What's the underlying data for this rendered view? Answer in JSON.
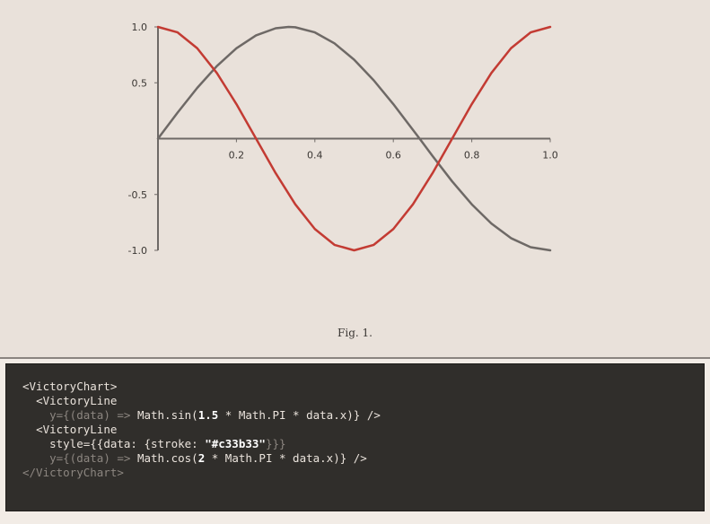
{
  "chart_data": {
    "type": "line",
    "xlim": [
      0,
      1
    ],
    "ylim": [
      -1,
      1
    ],
    "x_ticks": [
      "0.2",
      "0.4",
      "0.6",
      "0.8",
      "1.0"
    ],
    "x_tick_values": [
      0.2,
      0.4,
      0.6,
      0.8,
      1.0
    ],
    "y_ticks": [
      "1.0",
      "0.5",
      "-0.5",
      "-1.0"
    ],
    "y_tick_values": [
      1.0,
      0.5,
      -0.5,
      -1.0
    ],
    "grid": false,
    "legend": "none",
    "series": [
      {
        "color": "#6e6966",
        "x": [
          0,
          0.05,
          0.1,
          0.15,
          0.2,
          0.25,
          0.3,
          0.333,
          0.35,
          0.4,
          0.45,
          0.5,
          0.55,
          0.6,
          0.65,
          0.667,
          0.7,
          0.75,
          0.8,
          0.85,
          0.9,
          0.95,
          1.0
        ],
        "y": [
          0,
          0.233,
          0.454,
          0.649,
          0.809,
          0.924,
          0.988,
          1.0,
          0.997,
          0.951,
          0.853,
          0.707,
          0.522,
          0.309,
          0.078,
          0,
          -0.156,
          -0.383,
          -0.588,
          -0.76,
          -0.891,
          -0.972,
          -1.0
        ]
      },
      {
        "color": "#c33b33",
        "x": [
          0,
          0.05,
          0.1,
          0.15,
          0.2,
          0.25,
          0.3,
          0.35,
          0.4,
          0.45,
          0.5,
          0.55,
          0.6,
          0.65,
          0.7,
          0.75,
          0.8,
          0.85,
          0.9,
          0.95,
          1.0
        ],
        "y": [
          1.0,
          0.951,
          0.809,
          0.588,
          0.309,
          0,
          -0.309,
          -0.588,
          -0.809,
          -0.951,
          -1.0,
          -0.951,
          -0.809,
          -0.588,
          -0.309,
          0,
          0.309,
          0.588,
          0.809,
          0.951,
          1.0
        ]
      }
    ]
  },
  "caption": "Fig. 1.",
  "code": {
    "l1_open": "<VictoryChart>",
    "l2_open": "<VictoryLine",
    "l3_a": "y={(data) => ",
    "l3_b": "Math.sin(",
    "l3_c": "1.5",
    "l3_d": " * Math.PI * data.x)} />",
    "l4_open": "<VictoryLine",
    "l5_a": "style={{data: {stroke: ",
    "l5_b": "\"#c33b33\"",
    "l5_c": "}}}",
    "l6_a": "y={(data) => ",
    "l6_b": "Math.cos(",
    "l6_c": "2",
    "l6_d": " * Math.PI * data.x)} />",
    "l7_close": "</VictoryChart>"
  }
}
